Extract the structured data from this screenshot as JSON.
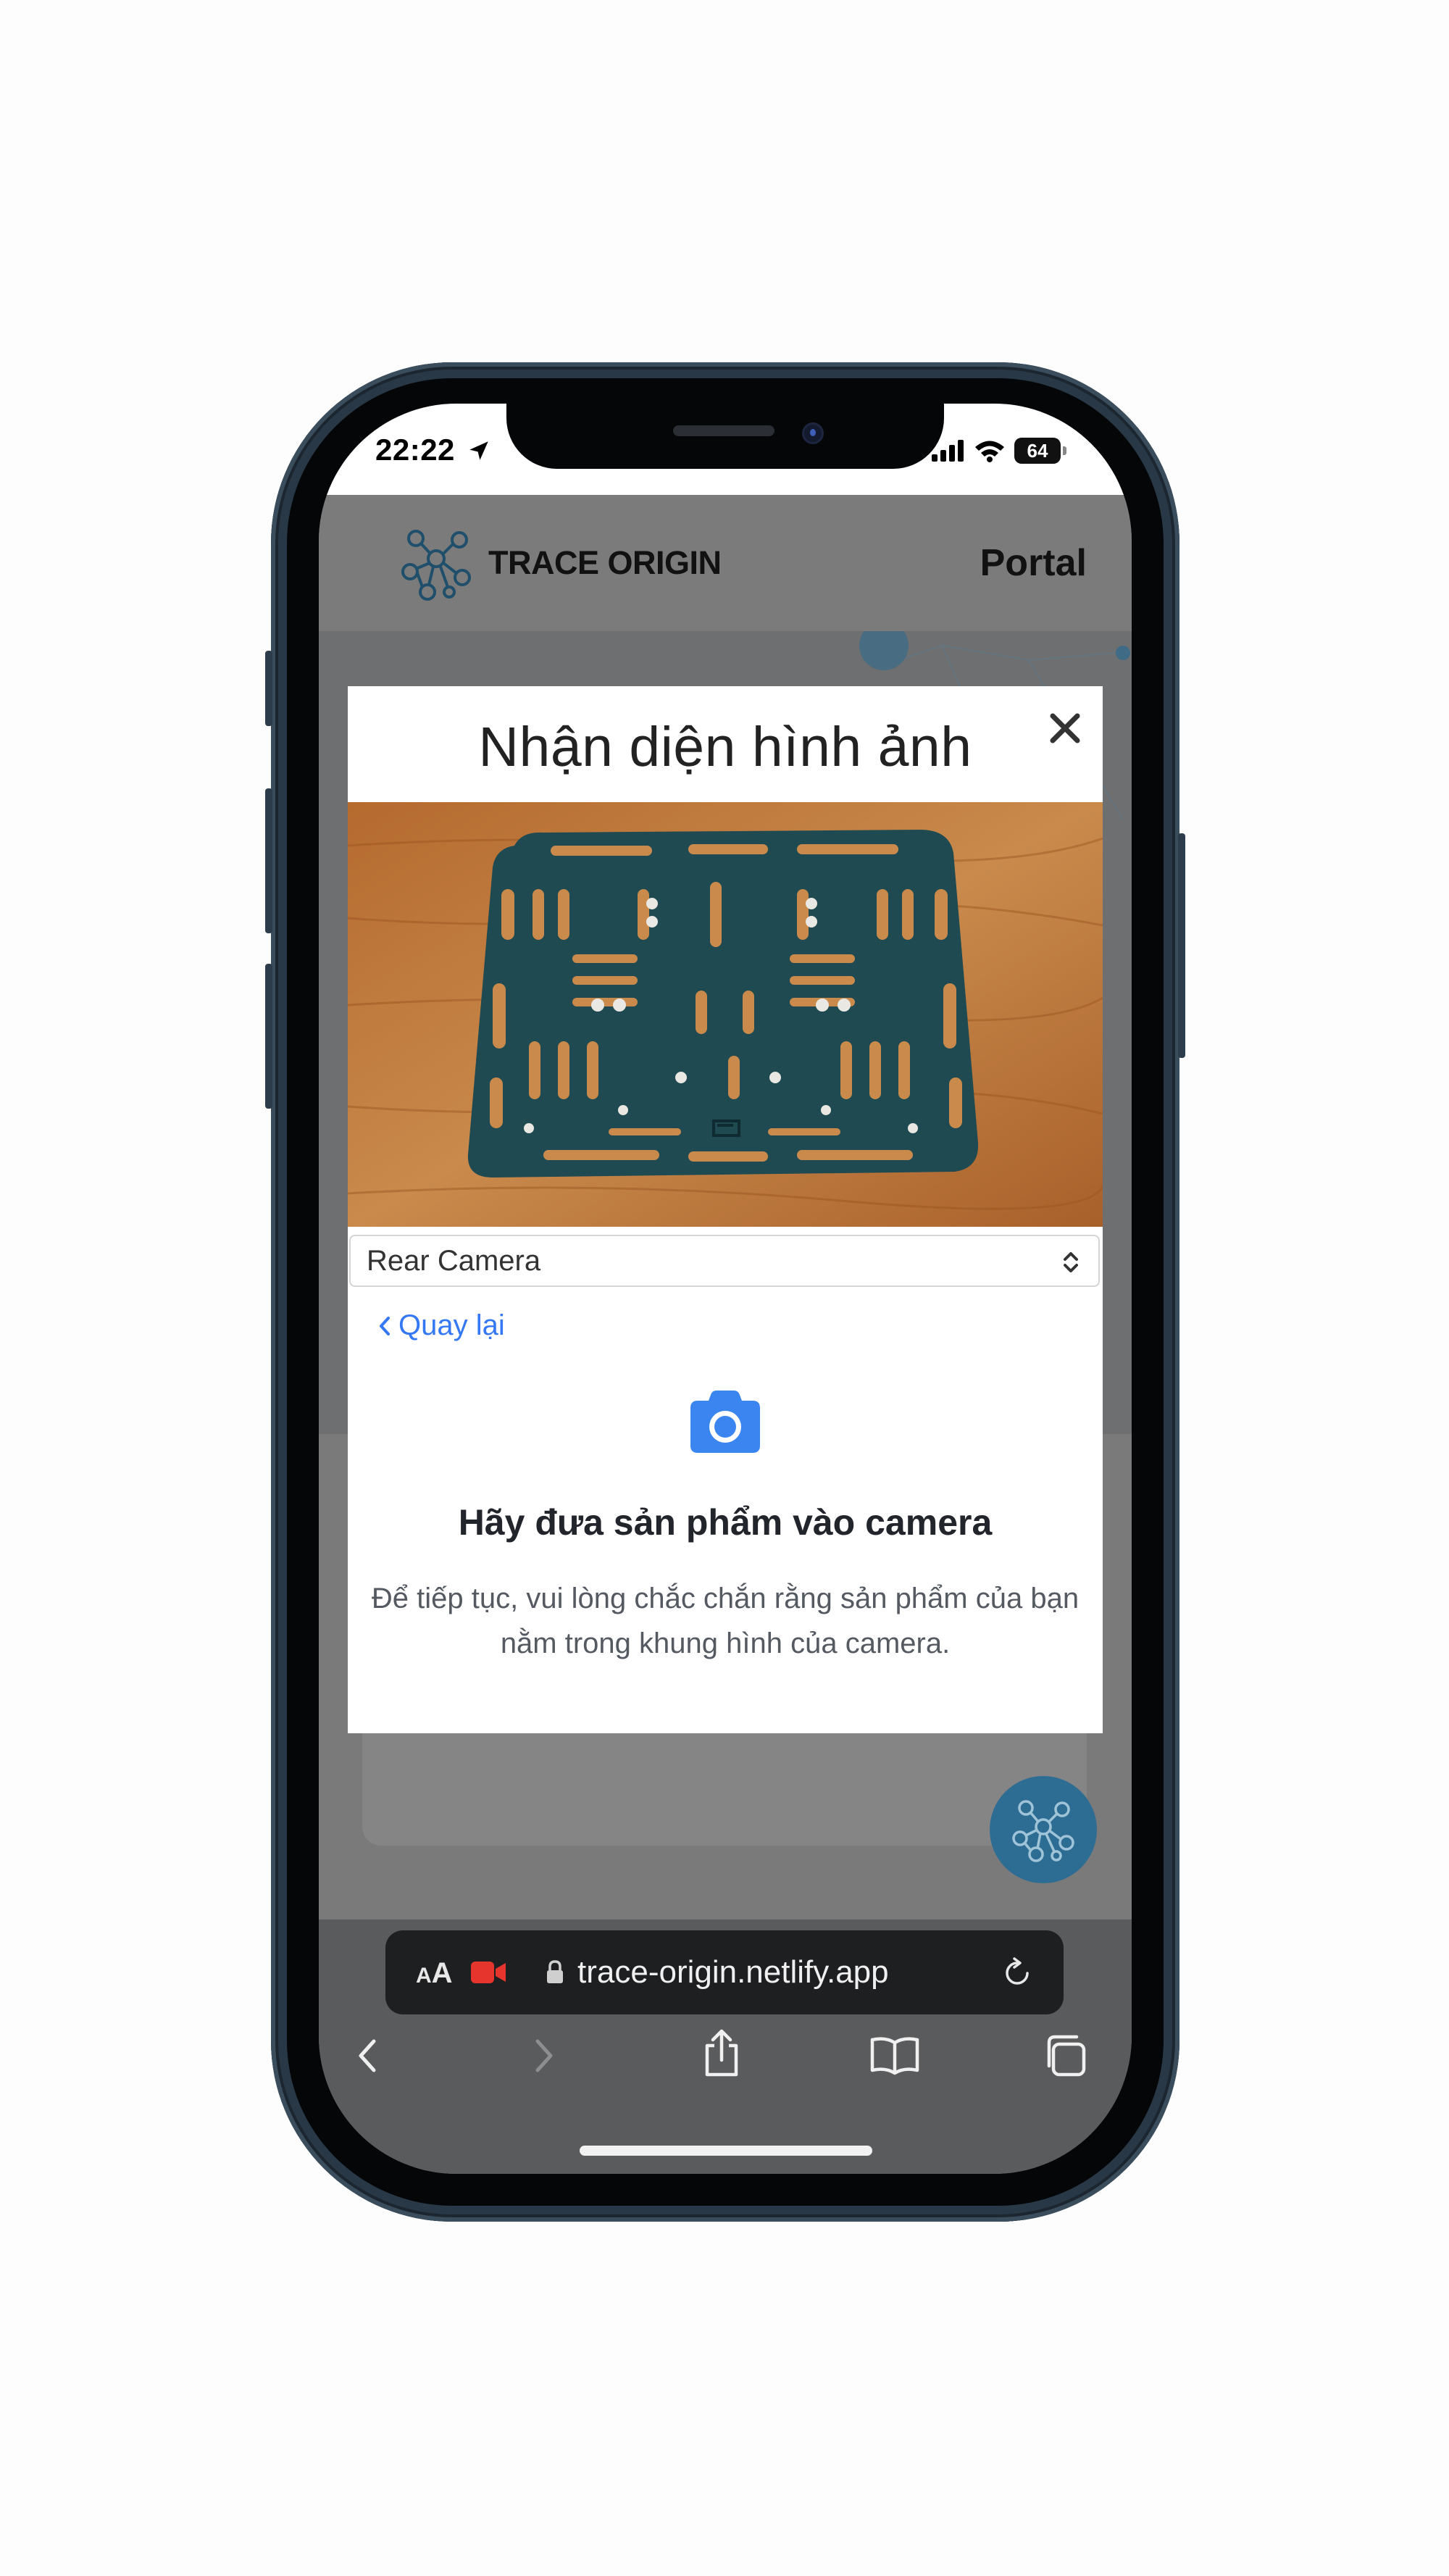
{
  "status_bar": {
    "time": "22:22",
    "battery": "64"
  },
  "site": {
    "brand": "TRACE ORIGIN",
    "nav_link": "Portal"
  },
  "modal": {
    "title": "Nhận diện hình ảnh",
    "camera_select": {
      "selected": "Rear Camera"
    },
    "back_link": "Quay lại",
    "heading": "Hãy đưa sản phẩm vào camera",
    "description_line1": "Để tiếp tục, vui lòng chắc chắn rằng sản phẩm của bạn",
    "description_line2": "nằm trong khung hình của camera."
  },
  "browser": {
    "text_size_label_small": "A",
    "text_size_label_large": "A",
    "url": "trace-origin.netlify.app"
  },
  "colors": {
    "accent": "#3478f6",
    "camera_icon": "#3a85f0",
    "fab": "#2e6d93",
    "recording": "#e5352d"
  }
}
